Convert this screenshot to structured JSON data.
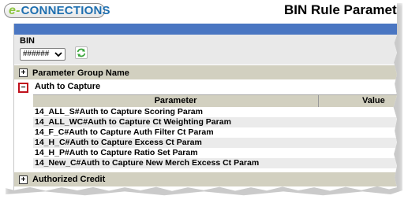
{
  "app": {
    "logo_prefix": "e-",
    "logo_text": "CONNECTIONS",
    "page_title": "BIN Rule Paramete"
  },
  "bin": {
    "label": "BIN",
    "selected_value": "######"
  },
  "groups": {
    "header_label": "Parameter Group Name",
    "expanded_label": "Auth to Capture",
    "collapsed_label": "Authorized Credit"
  },
  "table": {
    "col_parameter": "Parameter",
    "col_value": "Value",
    "rows": [
      "14_ALL_S#Auth to Capture Scoring Param",
      "14_ALL_WC#Auth to Capture Ct Weighting Param",
      "14_F_C#Auth to Capture Auth Filter Ct Param",
      "14_H_C#Auth to Capture Excess Ct Param",
      "14_H_P#Auth to Capture Ratio Set Param",
      "14_New_C#Auth to Capture New Merch Excess Ct Param"
    ]
  },
  "colors": {
    "blue_bar": "#4a76c2",
    "group_header_bg": "#d2d0c0",
    "minus_border": "#c0111d",
    "logo_blue": "#1e6fb0",
    "logo_green": "#8cc63f"
  },
  "icons": {
    "expand": "plus-box-icon",
    "collapse": "minus-box-icon",
    "refresh": "refresh-icon",
    "dropdown": "chevron-down-icon"
  }
}
